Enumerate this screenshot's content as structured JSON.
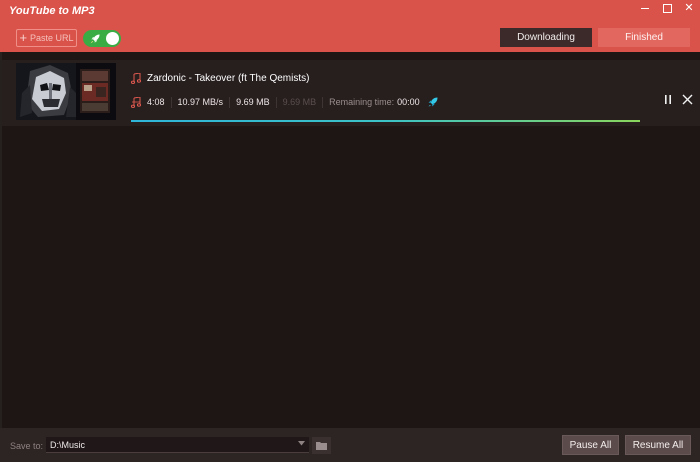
{
  "app": {
    "title": "YouTube to MP3"
  },
  "toolbar": {
    "paste_label": "Paste URL",
    "turbo_toggle_on": true
  },
  "tabs": [
    {
      "label": "Downloading",
      "active": true
    },
    {
      "label": "Finished",
      "active": false
    }
  ],
  "download": {
    "title": "Zardonic - Takeover (ft The Qemists)",
    "duration": "4:08",
    "speed": "10.97 MB/s",
    "downloaded": "9.69 MB",
    "total": "9.69 MB",
    "remaining_label": "Remaining time:",
    "remaining_value": "00:00",
    "progress": 1.0
  },
  "footer": {
    "save_to_label": "Save to:",
    "path": "D:\\Music",
    "pause_all": "Pause All",
    "resume_all": "Resume All"
  },
  "colors": {
    "titlebar": "#d9534a",
    "tab_active": "#3c2a2a",
    "tab_inactive": "#e2675f",
    "toggle_on": "#39ad43",
    "background": "#1e1515",
    "progress_start": "#2fb5d9",
    "progress_end": "#8ad65c"
  }
}
